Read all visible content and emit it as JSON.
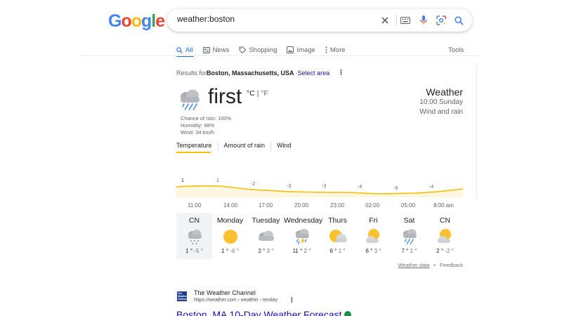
{
  "logo": {
    "letters": [
      "G",
      "o",
      "o",
      "g",
      "l",
      "e"
    ]
  },
  "search": {
    "query": "weather:boston"
  },
  "tabs": [
    {
      "label": "All",
      "icon": "search-icon"
    },
    {
      "label": "News",
      "icon": "news-icon"
    },
    {
      "label": "Shopping",
      "icon": "tag-icon"
    },
    {
      "label": "Image",
      "icon": "image-icon"
    },
    {
      "label": "More",
      "icon": "more-vert-icon"
    }
  ],
  "tools_label": "Tools",
  "results_for": {
    "prefix": "Results for",
    "location": "Boston, Massachusetts, USA",
    "separator": " · ",
    "select_area": "Select area"
  },
  "weather": {
    "condition_icon": "rain-cloud-icon",
    "temperature": "first",
    "unit_c": "°C",
    "unit_sep": " | ",
    "unit_f": "°F",
    "chance_of_rain": "Chance of rain: 100%",
    "humidity": "Humidity: 98%",
    "wind": "Wind: 34 km/h",
    "title": "Weather",
    "time": "10:00 Sunday",
    "condition": "Wind and rain",
    "subtabs": [
      "Temperature",
      "Amount of rain",
      "Wind"
    ],
    "chart_labels": [
      "1",
      "1",
      "-2",
      "-3",
      "-3",
      "-4",
      "-5",
      "-4"
    ],
    "times": [
      "11:00",
      "14:00",
      "17:00",
      "20:00",
      "23:00",
      "02:00",
      "05:00",
      "8:00 am"
    ],
    "days": [
      {
        "name": "CN",
        "icon": "snow-cloud-icon",
        "hi": "1 °",
        "lo": "-5 °"
      },
      {
        "name": "Monday",
        "icon": "sun-icon",
        "hi": "1 °",
        "lo": "-6 °"
      },
      {
        "name": "Tuesday",
        "icon": "cloud-icon",
        "hi": "2 °",
        "lo": "3 °"
      },
      {
        "name": "Wednesday",
        "icon": "thunderstorm-icon",
        "hi": "11 °",
        "lo": "2 °"
      },
      {
        "name": "Thurs",
        "icon": "partly-sunny-icon",
        "hi": "6 °",
        "lo": "1 °"
      },
      {
        "name": "Fri",
        "icon": "partly-cloudy-icon",
        "hi": "6 °",
        "lo": "3 °"
      },
      {
        "name": "Sat",
        "icon": "rain-cloud-icon",
        "hi": "7 °",
        "lo": "1 °"
      },
      {
        "name": "CN",
        "icon": "partly-cloudy-icon",
        "hi": "2 °",
        "lo": "-2 °"
      }
    ],
    "weather_data_link": "Weather data",
    "dot": "•",
    "feedback": "Feedback"
  },
  "result": {
    "logo_text": "The Weather Channel",
    "site": "The Weather Channel",
    "url": "https://weather.com › weather › tenday",
    "title": "Boston, MA 10-Day Weather Forecast"
  },
  "colors": {
    "accent": "#1a73e8",
    "link": "#1a0dab",
    "chart_line": "#fbbc04",
    "chart_fill": "#fef7e0"
  }
}
